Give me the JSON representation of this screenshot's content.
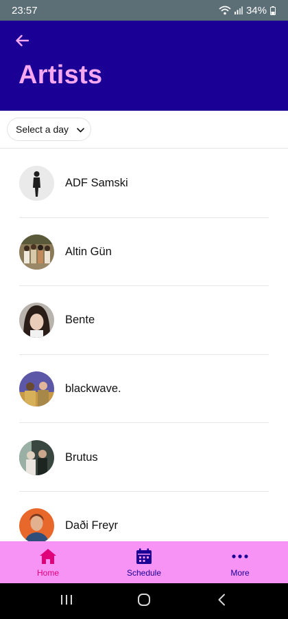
{
  "status_bar": {
    "time": "23:57",
    "battery": "34%"
  },
  "header": {
    "title": "Artists"
  },
  "filter": {
    "day_select_label": "Select a day"
  },
  "artists": [
    {
      "name": "ADF Samski"
    },
    {
      "name": "Altin Gün"
    },
    {
      "name": "Bente"
    },
    {
      "name": "blackwave."
    },
    {
      "name": "Brutus"
    },
    {
      "name": "Daði Freyr"
    }
  ],
  "bottom_nav": {
    "home_label": "Home",
    "schedule_label": "Schedule",
    "more_label": "More"
  },
  "colors": {
    "header_bg": "#1a0094",
    "title_color": "#f5a7f0",
    "nav_bg": "#f793f4",
    "nav_active": "#e0007a"
  }
}
